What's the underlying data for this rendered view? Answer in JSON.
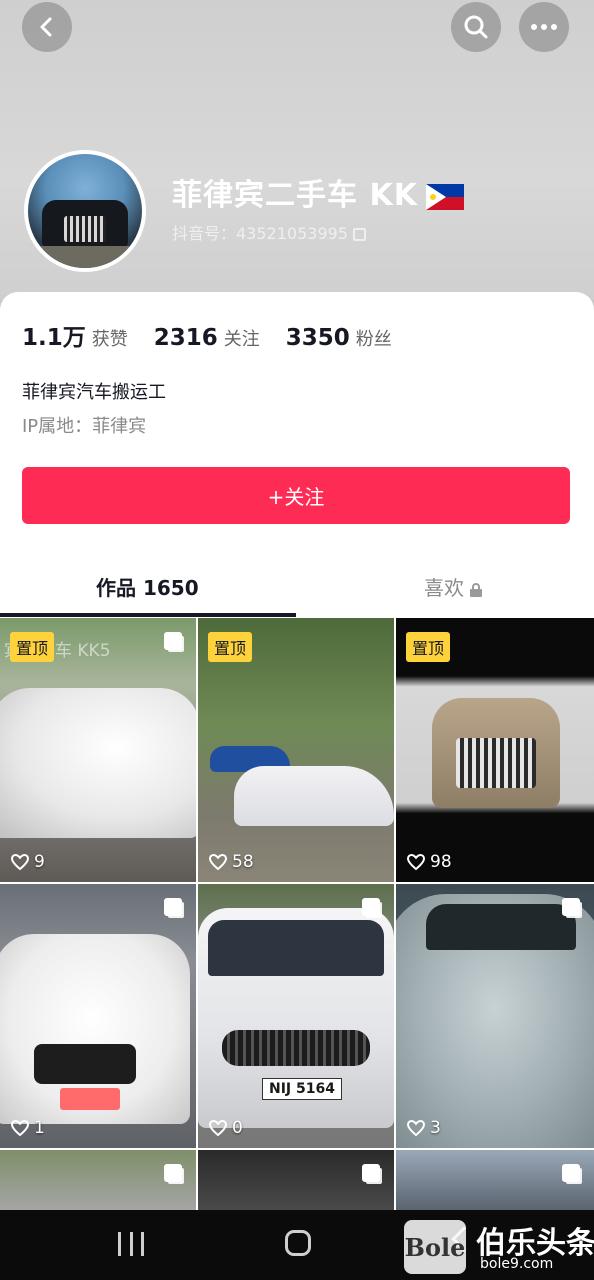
{
  "profile": {
    "name": "菲律宾二手车 KK",
    "account_label": "抖音号：43521053995",
    "bio": "菲律宾汽车搬运工",
    "ip": "IP属地：菲律宾"
  },
  "stats": [
    {
      "num": "1.1万",
      "label": "获赞"
    },
    {
      "num": "2316",
      "label": "关注"
    },
    {
      "num": "3350",
      "label": "粉丝"
    }
  ],
  "follow_button": "+关注",
  "tabs": {
    "works": "作品 1650",
    "likes": "喜欢"
  },
  "videos": [
    {
      "pinned": "置顶",
      "likes": "9",
      "watermark": "宾二手车 KK5"
    },
    {
      "pinned": "置顶",
      "likes": "58"
    },
    {
      "pinned": "置顶",
      "likes": "98"
    },
    {
      "likes": "1"
    },
    {
      "likes": "0",
      "plate": "NIJ 5164"
    },
    {
      "likes": "3"
    }
  ],
  "watermark": {
    "logo": "Bole",
    "text": "伯乐头条",
    "url": "bole9.com"
  },
  "colors": {
    "accent": "#fe2c55",
    "pin_badge": "#fdd23a"
  },
  "icons": [
    "back-icon",
    "search-icon",
    "more-icon",
    "copy-icon",
    "lock-icon",
    "heart-icon",
    "multi-image-icon"
  ]
}
